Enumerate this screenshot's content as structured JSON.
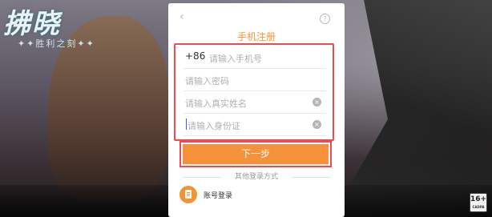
{
  "background": {
    "logo_text": "拂晓",
    "logo_subtitle": "✦✦胜利之刻✦✦",
    "age_rating": "16+",
    "age_rating_sub": "CADPA"
  },
  "dialog": {
    "title": "手机注册",
    "fields": {
      "phone": {
        "prefix": "+86",
        "placeholder": "请输入手机号"
      },
      "password": {
        "placeholder": "请输入密码"
      },
      "real_name": {
        "placeholder": "请输入真实姓名"
      },
      "id_number": {
        "placeholder": "请输入身份证"
      }
    },
    "next_label": "下一步",
    "other_login_label": "其他登录方式",
    "account_login_label": "账号登录"
  },
  "colors": {
    "accent": "#f5913a",
    "highlight": "#ee4b51"
  }
}
